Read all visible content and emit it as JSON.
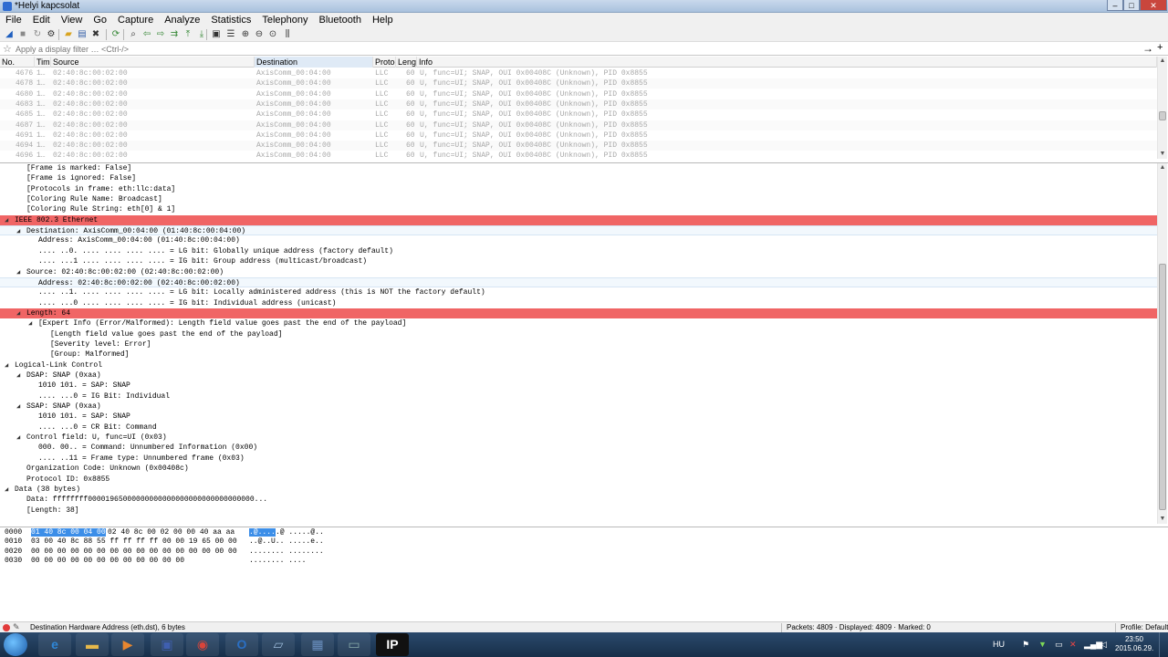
{
  "window": {
    "title": "*Helyi kapcsolat",
    "minimize": "–",
    "maximize": "□",
    "close": "✕"
  },
  "menu": [
    "File",
    "Edit",
    "View",
    "Go",
    "Capture",
    "Analyze",
    "Statistics",
    "Telephony",
    "Bluetooth",
    "Help"
  ],
  "toolbar": [
    {
      "name": "start-capture",
      "glyph": "◢",
      "color": "#1f5fbf"
    },
    {
      "name": "stop-capture",
      "glyph": "■",
      "color": "#8a8a8a"
    },
    {
      "name": "restart-capture",
      "glyph": "↻",
      "color": "#8a8a8a"
    },
    {
      "name": "capture-options",
      "glyph": "⚙",
      "color": "#333"
    },
    {
      "name": "open-file",
      "glyph": "▰",
      "color": "#d9a420"
    },
    {
      "name": "save-file",
      "glyph": "▤",
      "color": "#3560a8"
    },
    {
      "name": "close-file",
      "glyph": "✖",
      "color": "#333"
    },
    {
      "name": "reload-file",
      "glyph": "⟳",
      "color": "#3a8a3a"
    },
    {
      "name": "find-packet",
      "glyph": "⌕",
      "color": "#333"
    },
    {
      "name": "go-back",
      "glyph": "⇦",
      "color": "#3a8a3a"
    },
    {
      "name": "go-forward",
      "glyph": "⇨",
      "color": "#3a8a3a"
    },
    {
      "name": "go-to-packet",
      "glyph": "⇉",
      "color": "#3a8a3a"
    },
    {
      "name": "first-packet",
      "glyph": "⤒",
      "color": "#3a8a3a"
    },
    {
      "name": "last-packet",
      "glyph": "⤓",
      "color": "#3a8a3a"
    },
    {
      "name": "autoscroll",
      "glyph": "▣",
      "color": "#333"
    },
    {
      "name": "colorize",
      "glyph": "☰",
      "color": "#333"
    },
    {
      "name": "zoom-in",
      "glyph": "⊕",
      "color": "#333"
    },
    {
      "name": "zoom-out",
      "glyph": "⊖",
      "color": "#333"
    },
    {
      "name": "zoom-normal",
      "glyph": "⊙",
      "color": "#333"
    },
    {
      "name": "resize-columns",
      "glyph": "⫼",
      "color": "#333"
    }
  ],
  "filter": {
    "placeholder": "Apply a display filter … <Ctrl-/>",
    "apply": "→",
    "expression": "+"
  },
  "packet_list": {
    "columns": [
      "No.",
      "Time",
      "Source",
      "Destination",
      "Protocol",
      "Length",
      "Info"
    ],
    "column_labels": [
      "No.",
      "Time",
      "Source",
      "Destination",
      "Protoc",
      "Lengt",
      "Info"
    ],
    "rows": [
      {
        "no": "4676",
        "time": "1…",
        "src": "02:40:8c:00:02:00",
        "dst": "AxisComm_00:04:00",
        "proto": "LLC",
        "len": "60",
        "info": "U, func=UI; SNAP, OUI 0x00408C (Unknown), PID 0x8855"
      },
      {
        "no": "4678",
        "time": "1…",
        "src": "02:40:8c:00:02:00",
        "dst": "AxisComm_00:04:00",
        "proto": "LLC",
        "len": "60",
        "info": "U, func=UI; SNAP, OUI 0x00408C (Unknown), PID 0x8855"
      },
      {
        "no": "4680",
        "time": "1…",
        "src": "02:40:8c:00:02:00",
        "dst": "AxisComm_00:04:00",
        "proto": "LLC",
        "len": "60",
        "info": "U, func=UI; SNAP, OUI 0x00408C (Unknown), PID 0x8855"
      },
      {
        "no": "4683",
        "time": "1…",
        "src": "02:40:8c:00:02:00",
        "dst": "AxisComm_00:04:00",
        "proto": "LLC",
        "len": "60",
        "info": "U, func=UI; SNAP, OUI 0x00408C (Unknown), PID 0x8855"
      },
      {
        "no": "4685",
        "time": "1…",
        "src": "02:40:8c:00:02:00",
        "dst": "AxisComm_00:04:00",
        "proto": "LLC",
        "len": "60",
        "info": "U, func=UI; SNAP, OUI 0x00408C (Unknown), PID 0x8855"
      },
      {
        "no": "4687",
        "time": "1…",
        "src": "02:40:8c:00:02:00",
        "dst": "AxisComm_00:04:00",
        "proto": "LLC",
        "len": "60",
        "info": "U, func=UI; SNAP, OUI 0x00408C (Unknown), PID 0x8855"
      },
      {
        "no": "4691",
        "time": "1…",
        "src": "02:40:8c:00:02:00",
        "dst": "AxisComm_00:04:00",
        "proto": "LLC",
        "len": "60",
        "info": "U, func=UI; SNAP, OUI 0x00408C (Unknown), PID 0x8855"
      },
      {
        "no": "4694",
        "time": "1…",
        "src": "02:40:8c:00:02:00",
        "dst": "AxisComm_00:04:00",
        "proto": "LLC",
        "len": "60",
        "info": "U, func=UI; SNAP, OUI 0x00408C (Unknown), PID 0x8855"
      },
      {
        "no": "4696",
        "time": "1…",
        "src": "02:40:8c:00:02:00",
        "dst": "AxisComm_00:04:00",
        "proto": "LLC",
        "len": "60",
        "info": "U, func=UI; SNAP, OUI 0x00408C (Unknown), PID 0x8855"
      }
    ]
  },
  "details": [
    {
      "indent": 2,
      "tw": "",
      "text": "[Frame is marked: False]"
    },
    {
      "indent": 2,
      "tw": "",
      "text": "[Frame is ignored: False]"
    },
    {
      "indent": 2,
      "tw": "",
      "text": "[Protocols in frame: eth:llc:data]"
    },
    {
      "indent": 2,
      "tw": "",
      "text": "[Coloring Rule Name: Broadcast]"
    },
    {
      "indent": 2,
      "tw": "",
      "text": "[Coloring Rule String: eth[0] & 1]"
    },
    {
      "indent": 1,
      "tw": "◢",
      "text": "IEEE 802.3 Ethernet",
      "style": "err"
    },
    {
      "indent": 2,
      "tw": "◢",
      "text": "Destination: AxisComm_00:04:00 (01:40:8c:00:04:00)",
      "style": "sel"
    },
    {
      "indent": 3,
      "tw": "",
      "text": "Address: AxisComm_00:04:00 (01:40:8c:00:04:00)"
    },
    {
      "indent": 3,
      "tw": "",
      "text": ".... ..0. .... .... .... .... = LG bit: Globally unique address (factory default)"
    },
    {
      "indent": 3,
      "tw": "",
      "text": ".... ...1 .... .... .... .... = IG bit: Group address (multicast/broadcast)"
    },
    {
      "indent": 2,
      "tw": "◢",
      "text": "Source: 02:40:8c:00:02:00 (02:40:8c:00:02:00)"
    },
    {
      "indent": 3,
      "tw": "",
      "text": "Address: 02:40:8c:00:02:00 (02:40:8c:00:02:00)",
      "style": "sel"
    },
    {
      "indent": 3,
      "tw": "",
      "text": ".... ..1. .... .... .... .... = LG bit: Locally administered address (this is NOT the factory default)"
    },
    {
      "indent": 3,
      "tw": "",
      "text": ".... ...0 .... .... .... .... = IG bit: Individual address (unicast)"
    },
    {
      "indent": 2,
      "tw": "◢",
      "text": "Length: 64",
      "style": "err"
    },
    {
      "indent": 3,
      "tw": "◢",
      "text": "[Expert Info (Error/Malformed): Length field value goes past the end of the payload]"
    },
    {
      "indent": 4,
      "tw": "",
      "text": "[Length field value goes past the end of the payload]"
    },
    {
      "indent": 4,
      "tw": "",
      "text": "[Severity level: Error]"
    },
    {
      "indent": 4,
      "tw": "",
      "text": "[Group: Malformed]"
    },
    {
      "indent": 1,
      "tw": "◢",
      "text": "Logical-Link Control"
    },
    {
      "indent": 2,
      "tw": "◢",
      "text": "DSAP: SNAP (0xaa)"
    },
    {
      "indent": 3,
      "tw": "",
      "text": "1010 101. = SAP: SNAP"
    },
    {
      "indent": 3,
      "tw": "",
      "text": ".... ...0 = IG Bit: Individual"
    },
    {
      "indent": 2,
      "tw": "◢",
      "text": "SSAP: SNAP (0xaa)"
    },
    {
      "indent": 3,
      "tw": "",
      "text": "1010 101. = SAP: SNAP"
    },
    {
      "indent": 3,
      "tw": "",
      "text": ".... ...0 = CR Bit: Command"
    },
    {
      "indent": 2,
      "tw": "◢",
      "text": "Control field: U, func=UI (0x03)"
    },
    {
      "indent": 3,
      "tw": "",
      "text": "000. 00.. = Command: Unnumbered Information (0x00)"
    },
    {
      "indent": 3,
      "tw": "",
      "text": ".... ..11 = Frame type: Unnumbered frame (0x03)"
    },
    {
      "indent": 2,
      "tw": "",
      "text": "Organization Code: Unknown (0x00408c)"
    },
    {
      "indent": 2,
      "tw": "",
      "text": "Protocol ID: 0x8855"
    },
    {
      "indent": 1,
      "tw": "◢",
      "text": "Data (38 bytes)"
    },
    {
      "indent": 2,
      "tw": "",
      "text": "Data: ffffffff00001965000000000000000000000000000000..."
    },
    {
      "indent": 2,
      "tw": "",
      "text": "[Length: 38]"
    }
  ],
  "bytes": [
    {
      "offset": "0000",
      "hex_sel": "01 40 8c 00 04 00",
      "hex_rest": "02 40  8c 00 02 00 00 40 aa aa",
      "ascii_sel": ".@....",
      "ascii_rest": ".@ .....@.."
    },
    {
      "offset": "0010",
      "hex_sel": "",
      "hex_rest": "03 00 40 8c 88 55 ff ff  ff ff 00 00 19 65 00 00",
      "ascii_sel": "",
      "ascii_rest": "..@..U.. .....e.."
    },
    {
      "offset": "0020",
      "hex_sel": "",
      "hex_rest": "00 00 00 00 00 00 00 00  00 00 00 00 00 00 00 00",
      "ascii_sel": "",
      "ascii_rest": "........ ........"
    },
    {
      "offset": "0030",
      "hex_sel": "",
      "hex_rest": "00 00 00 00 00 00 00 00  00 00 00 00",
      "ascii_sel": "",
      "ascii_rest": "........ ...."
    }
  ],
  "status": {
    "field": "Destination Hardware Address (eth.dst), 6 bytes",
    "packets": "Packets: 4809 · Displayed: 4809 · Marked: 0",
    "profile": "Profile: Default"
  },
  "taskbar": {
    "apps": [
      {
        "name": "internet-explorer",
        "glyph": "e",
        "color": "#2f86d6"
      },
      {
        "name": "file-explorer",
        "glyph": "▬",
        "color": "#e6b84a"
      },
      {
        "name": "media-player",
        "glyph": "▶",
        "color": "#e8862f"
      },
      {
        "name": "floppy-app",
        "glyph": "▣",
        "color": "#3f5fb0"
      },
      {
        "name": "chrome",
        "glyph": "◉",
        "color": "#d9443a"
      },
      {
        "name": "outlook",
        "glyph": "O",
        "color": "#2a6fc4"
      },
      {
        "name": "notes-app",
        "glyph": "▱",
        "color": "#9ab8d8"
      },
      {
        "name": "network-app",
        "glyph": "▦",
        "color": "#6a8fbf"
      },
      {
        "name": "window-app",
        "glyph": "▭",
        "color": "#8aa"
      },
      {
        "name": "ip-app",
        "glyph": "IP",
        "color": "#1b1b1b"
      }
    ],
    "lang": "HU",
    "time": "23:50",
    "date": "2015.06.29."
  },
  "colors": {
    "error_row": "#f06565",
    "selection": "#3c8ee8",
    "taskbar": "#1f3c5c"
  }
}
